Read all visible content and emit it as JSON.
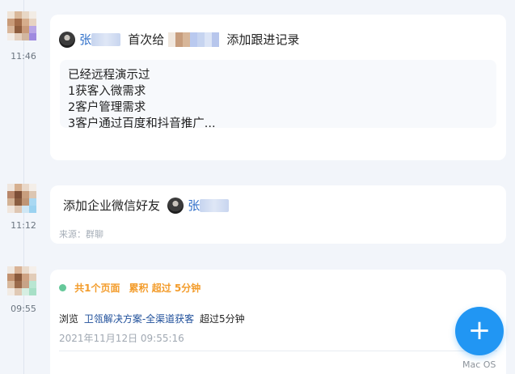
{
  "entries": [
    {
      "time": "11:46",
      "header_name": "张",
      "header_mid": "首次给",
      "header_end": "添加跟进记录",
      "note_lines": [
        "已经远程演示过",
        "1获客入微需求",
        "2客户管理需求",
        "3客户通过百度和抖音推广..."
      ]
    },
    {
      "time": "11:12",
      "action": "添加企业微信好友",
      "friend_name": "张",
      "source": "来源：群聊"
    },
    {
      "time": "09:55",
      "summary_pages": "共1个页面",
      "summary_accum": "累积 超过 5分钟",
      "browse_prefix": "浏览",
      "page_title": "卫瓴解决方案-全渠道获客",
      "browse_suffix": "超过5分钟",
      "date": "2021年11月12日 09:55:16"
    }
  ],
  "fab": {
    "icon": "plus-icon",
    "label": "+"
  },
  "os_label": "Mac OS",
  "colors": {
    "accent": "#2196f3",
    "link": "#2f6fc9",
    "orange": "#f39c2b",
    "green": "#66c89a"
  }
}
